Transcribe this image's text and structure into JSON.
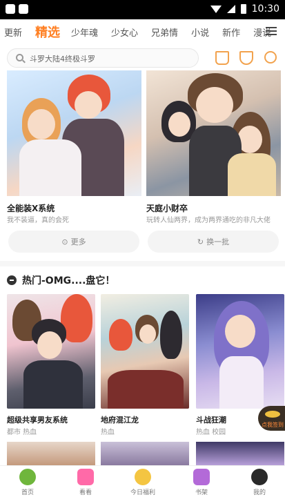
{
  "statusbar": {
    "time": "10:30"
  },
  "tabs": [
    {
      "label": "更新"
    },
    {
      "label": "精选",
      "active": true
    },
    {
      "label": "少年魂"
    },
    {
      "label": "少女心"
    },
    {
      "label": "兄弟情"
    },
    {
      "label": "小说"
    },
    {
      "label": "新作"
    },
    {
      "label": "漫说"
    }
  ],
  "search": {
    "text": "斗罗大陆4终极斗罗"
  },
  "featured": [
    {
      "title": "全能装X系统",
      "subtitle": "我不装逼，真的会死"
    },
    {
      "title": "天庭小财卒",
      "subtitle": "玩转人仙两界，成为两界通吃的非凡大佬"
    }
  ],
  "buttons": {
    "more": "更多",
    "refresh": "换一批"
  },
  "section": {
    "title": "热门-OMG....盘它！"
  },
  "cards": [
    {
      "title": "超级共享男友系统",
      "tags": "都市 热血"
    },
    {
      "title": "地府混江龙",
      "tags": "热血"
    },
    {
      "title": "斗战狂潮",
      "tags": "热血 校园"
    }
  ],
  "float_badge": {
    "text": "点我签到"
  },
  "bottom_nav": [
    {
      "label": "首页"
    },
    {
      "label": "看看"
    },
    {
      "label": "今日福利"
    },
    {
      "label": "书架"
    },
    {
      "label": "我的"
    }
  ],
  "colors": {
    "accent": "#ff7f22",
    "home": "#6fb63c"
  }
}
